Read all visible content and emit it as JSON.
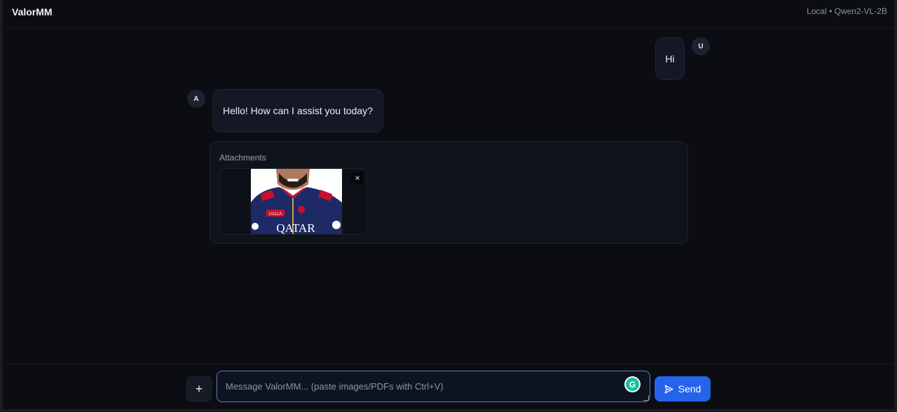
{
  "header": {
    "brand": "ValorMM",
    "model_status": "Local • Qwen2-VL-2B"
  },
  "messages": [
    {
      "role": "user",
      "avatar": "U",
      "text": "Hi"
    },
    {
      "role": "assistant",
      "avatar": "A",
      "text": "Hello! How can I assist you today?"
    }
  ],
  "attachments": {
    "title": "Attachments",
    "remove_label": "×",
    "items": [
      {
        "jersey_text": "QATAR",
        "sponsor_text": "LULLA"
      }
    ]
  },
  "composer": {
    "add_label": "+",
    "placeholder": "Message ValorMM... (paste images/PDFs with Ctrl+V)",
    "value": "",
    "grammarly_glyph": "G",
    "send_label": "Send"
  },
  "colors": {
    "accent": "#2563eb",
    "background": "#0b0d12",
    "bubble": "#131824"
  },
  "icons": [
    "plus-icon",
    "send-icon",
    "close-icon",
    "grammarly-icon"
  ]
}
